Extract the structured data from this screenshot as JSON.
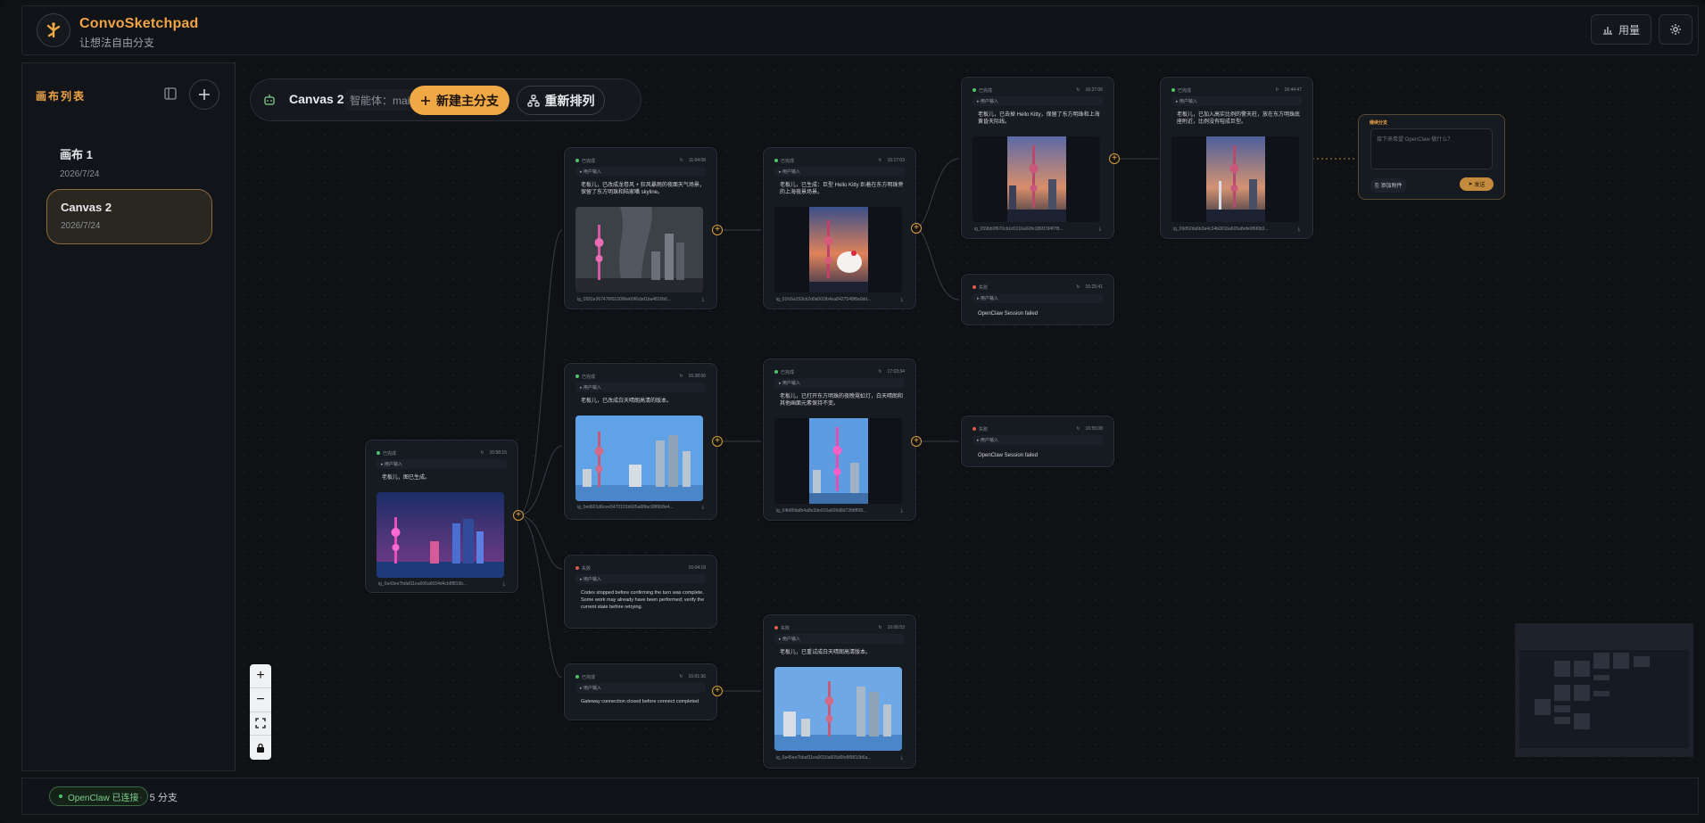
{
  "app": {
    "title": "ConvoSketchpad",
    "subtitle": "让想法自由分支"
  },
  "header": {
    "usage_label": "用量"
  },
  "sidebar": {
    "title": "画布列表",
    "canvases": [
      {
        "name": "画布 1",
        "date": "2026/7/24",
        "active": false
      },
      {
        "name": "Canvas 2",
        "date": "2026/7/24",
        "active": true
      }
    ]
  },
  "toolbar": {
    "canvas_name": "Canvas 2",
    "agent_label": "智能体：main",
    "new_branch_label": "新建主分支",
    "rearrange_label": "重新排列"
  },
  "nodes": [
    {
      "id": "root",
      "status": "已完成",
      "time": "10:58:15",
      "input_label": "▸ 用户输入",
      "text": "老板儿，图已生成。",
      "file": "ig_0a43ee7bdaf11ea006a6034d4cb8f810b...",
      "has_image": true
    },
    {
      "id": "a1",
      "status": "已完成",
      "time": "11:04:08",
      "input_label": "▸ 用户输入",
      "text": "老板儿，已改成龙卷风 + 狂风暴雨的夜面天气场景，保留了东方明珠和陆家嘴 skyline。",
      "file": "ig_0581e367476f010096e60f6cbd1ba4810b6...",
      "has_image": true
    },
    {
      "id": "a2",
      "status": "已完成",
      "time": "16:17:03",
      "input_label": "▸ 用户输入",
      "text": "老板儿，已生成：巨型 Hello Kitty 趴着在东方明珠旁的上海夜景场景。",
      "file": "ig_01fc6a153cb2d0a001fb4ea8427548f8a0dd...",
      "has_image": true
    },
    {
      "id": "a3",
      "status": "已完成",
      "time": "16:27:06",
      "input_label": "▸ 用户输入",
      "text": "老板儿，已去掉 Hello Kitty，保留了东方明珠和上海黄昏天际线。",
      "file": "ig_059bb0f670cb1d1016a60fe186f15f4f7f8...",
      "has_image": true
    },
    {
      "id": "a4",
      "status": "已完成",
      "time": "16:44:47",
      "input_label": "▸ 用户输入",
      "text": "老板儿，已加入高实比例的警天柱，放在东方明珠底座附近，比例没有喧成巨型。",
      "file": "ig_09d52da6b3a4c34b0016a605a8efe0f6f0b3...",
      "has_image": true
    },
    {
      "id": "a5",
      "status": "失败",
      "time": "16:25:41",
      "input_label": "▸ 用户输入",
      "text": "OpenClaw Session failed",
      "has_image": false
    },
    {
      "id": "b1",
      "status": "已完成",
      "time": "16:38:06",
      "input_label": "▸ 用户输入",
      "text": "老板儿，已改成白天晴朗高清的版本。",
      "file": "ig_0ed601d6cee5470101b605a88fac08f6b8e4...",
      "has_image": true
    },
    {
      "id": "b2",
      "status": "已完成",
      "time": "17:03:34",
      "input_label": "▸ 用户输入",
      "text": "老板儿，已打开东方明珠的夜晚霓虹灯，白天晴朗和其他画面元素保持不变。",
      "file": "ig_04b80dafb4a8e3de016a606d8d72fdf808...",
      "has_image": true
    },
    {
      "id": "b3",
      "status": "失败",
      "time": "16:55:08",
      "input_label": "▸ 用户输入",
      "text": "OpenClaw Session failed",
      "has_image": false
    },
    {
      "id": "c1",
      "status": "失败",
      "time": "16:04:18",
      "input_label": "▸ 用户输入",
      "text": "Codex stopped before confirming the turn was complete. Some work may already have been performed; verify the current state before retrying.",
      "has_image": false
    },
    {
      "id": "d1",
      "status": "已完成",
      "time": "16:01:36",
      "input_label": "▸ 用户输入",
      "text": "Gateway connection closed before connect completed",
      "has_image": false
    },
    {
      "id": "d2",
      "status": "失败",
      "time": "16:06:53",
      "input_label": "▸ 用户输入",
      "text": "老板儿，已重试成白天晴朗高清版本。",
      "file": "ig_0a45ee7bbaf11ea0016a605d6fe8f9810b6a...",
      "has_image": true
    }
  ],
  "compose": {
    "title": "继续分支",
    "placeholder": "接下来希望 OpenClaw 做什么？",
    "attach_label": "添加附件",
    "send_label": "发送"
  },
  "footer": {
    "status_label": "OpenClaw 已连接",
    "branches_label": "5 分支"
  },
  "colors": {
    "accent": "#f0a845",
    "success": "#4ec36a",
    "failure": "#e05a4a",
    "background": "#0f1115"
  }
}
